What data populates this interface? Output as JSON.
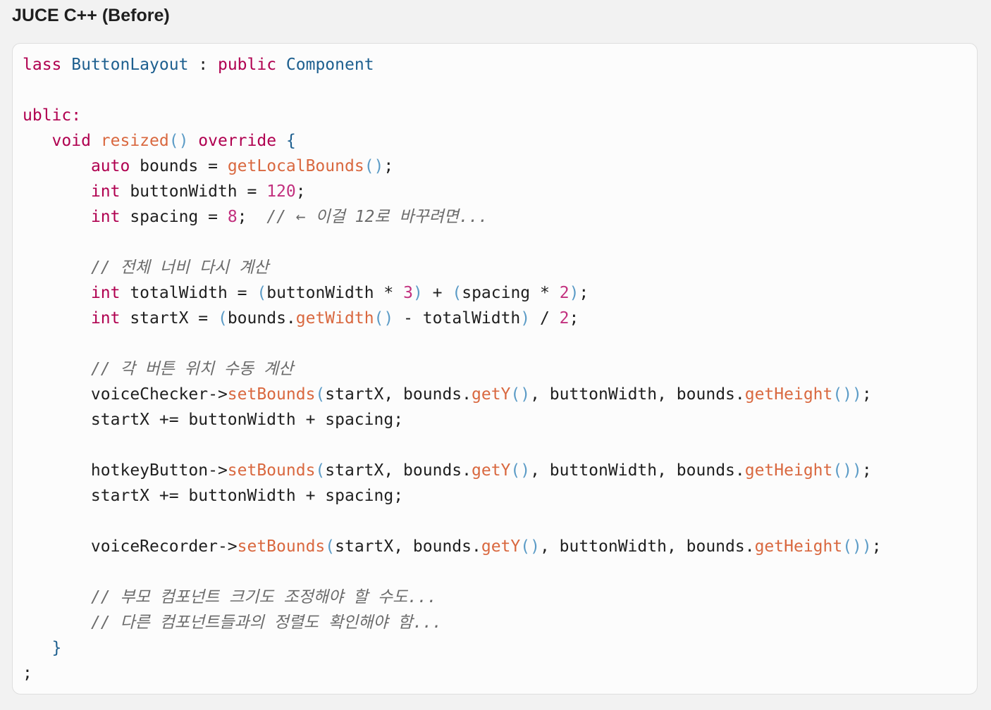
{
  "title": "JUCE C++ (Before)",
  "colors": {
    "keyword": "#b00050",
    "type": "#1d5f8f",
    "function": "#d9683f",
    "number": "#c2307e",
    "paren": "#5b9bc6",
    "comment": "#6b6b6b",
    "text": "#1f1f1f"
  },
  "code_lines": [
    [
      [
        "kw",
        "lass"
      ],
      [
        "pl",
        " "
      ],
      [
        "ty",
        "ButtonLayout"
      ],
      [
        "pl",
        " : "
      ],
      [
        "kw",
        "public"
      ],
      [
        "pl",
        " "
      ],
      [
        "ty",
        "Component"
      ]
    ],
    [],
    [
      [
        "kw",
        "ublic:"
      ]
    ],
    [
      [
        "pl",
        "   "
      ],
      [
        "kw",
        "void"
      ],
      [
        "pl",
        " "
      ],
      [
        "fn",
        "resized"
      ],
      [
        "paren",
        "()"
      ],
      [
        "pl",
        " "
      ],
      [
        "kw",
        "override"
      ],
      [
        "pl",
        " "
      ],
      [
        "ty",
        "{"
      ]
    ],
    [
      [
        "pl",
        "       "
      ],
      [
        "kw",
        "auto"
      ],
      [
        "pl",
        " bounds = "
      ],
      [
        "fn",
        "getLocalBounds"
      ],
      [
        "paren",
        "()"
      ],
      [
        "pl",
        ";"
      ]
    ],
    [
      [
        "pl",
        "       "
      ],
      [
        "kw",
        "int"
      ],
      [
        "pl",
        " buttonWidth = "
      ],
      [
        "num",
        "120"
      ],
      [
        "pl",
        ";"
      ]
    ],
    [
      [
        "pl",
        "       "
      ],
      [
        "kw",
        "int"
      ],
      [
        "pl",
        " spacing = "
      ],
      [
        "num",
        "8"
      ],
      [
        "pl",
        ";  "
      ],
      [
        "cm",
        "// ← 이걸 12로 바꾸려면..."
      ]
    ],
    [],
    [
      [
        "pl",
        "       "
      ],
      [
        "cm",
        "// 전체 너비 다시 계산"
      ]
    ],
    [
      [
        "pl",
        "       "
      ],
      [
        "kw",
        "int"
      ],
      [
        "pl",
        " totalWidth = "
      ],
      [
        "paren",
        "("
      ],
      [
        "pl",
        "buttonWidth * "
      ],
      [
        "num",
        "3"
      ],
      [
        "paren",
        ")"
      ],
      [
        "pl",
        " + "
      ],
      [
        "paren",
        "("
      ],
      [
        "pl",
        "spacing * "
      ],
      [
        "num",
        "2"
      ],
      [
        "paren",
        ")"
      ],
      [
        "pl",
        ";"
      ]
    ],
    [
      [
        "pl",
        "       "
      ],
      [
        "kw",
        "int"
      ],
      [
        "pl",
        " startX = "
      ],
      [
        "paren",
        "("
      ],
      [
        "pl",
        "bounds."
      ],
      [
        "fn",
        "getWidth"
      ],
      [
        "paren",
        "()"
      ],
      [
        "pl",
        " - totalWidth"
      ],
      [
        "paren",
        ")"
      ],
      [
        "pl",
        " / "
      ],
      [
        "num",
        "2"
      ],
      [
        "pl",
        ";"
      ]
    ],
    [],
    [
      [
        "pl",
        "       "
      ],
      [
        "cm",
        "// 각 버튼 위치 수동 계산"
      ]
    ],
    [
      [
        "pl",
        "       voiceChecker->"
      ],
      [
        "fn",
        "setBounds"
      ],
      [
        "paren",
        "("
      ],
      [
        "pl",
        "startX, bounds."
      ],
      [
        "fn",
        "getY"
      ],
      [
        "paren",
        "()"
      ],
      [
        "pl",
        ", buttonWidth, bounds."
      ],
      [
        "fn",
        "getHeight"
      ],
      [
        "paren",
        "())"
      ],
      [
        "pl",
        ";"
      ]
    ],
    [
      [
        "pl",
        "       startX += buttonWidth + spacing;"
      ]
    ],
    [],
    [
      [
        "pl",
        "       hotkeyButton->"
      ],
      [
        "fn",
        "setBounds"
      ],
      [
        "paren",
        "("
      ],
      [
        "pl",
        "startX, bounds."
      ],
      [
        "fn",
        "getY"
      ],
      [
        "paren",
        "()"
      ],
      [
        "pl",
        ", buttonWidth, bounds."
      ],
      [
        "fn",
        "getHeight"
      ],
      [
        "paren",
        "())"
      ],
      [
        "pl",
        ";"
      ]
    ],
    [
      [
        "pl",
        "       startX += buttonWidth + spacing;"
      ]
    ],
    [],
    [
      [
        "pl",
        "       voiceRecorder->"
      ],
      [
        "fn",
        "setBounds"
      ],
      [
        "paren",
        "("
      ],
      [
        "pl",
        "startX, bounds."
      ],
      [
        "fn",
        "getY"
      ],
      [
        "paren",
        "()"
      ],
      [
        "pl",
        ", buttonWidth, bounds."
      ],
      [
        "fn",
        "getHeight"
      ],
      [
        "paren",
        "())"
      ],
      [
        "pl",
        ";"
      ]
    ],
    [],
    [
      [
        "pl",
        "       "
      ],
      [
        "cm",
        "// 부모 컴포넌트 크기도 조정해야 할 수도..."
      ]
    ],
    [
      [
        "pl",
        "       "
      ],
      [
        "cm",
        "// 다른 컴포넌트들과의 정렬도 확인해야 함..."
      ]
    ],
    [
      [
        "pl",
        "   "
      ],
      [
        "ty",
        "}"
      ]
    ],
    [
      [
        "pl",
        ";"
      ]
    ]
  ]
}
